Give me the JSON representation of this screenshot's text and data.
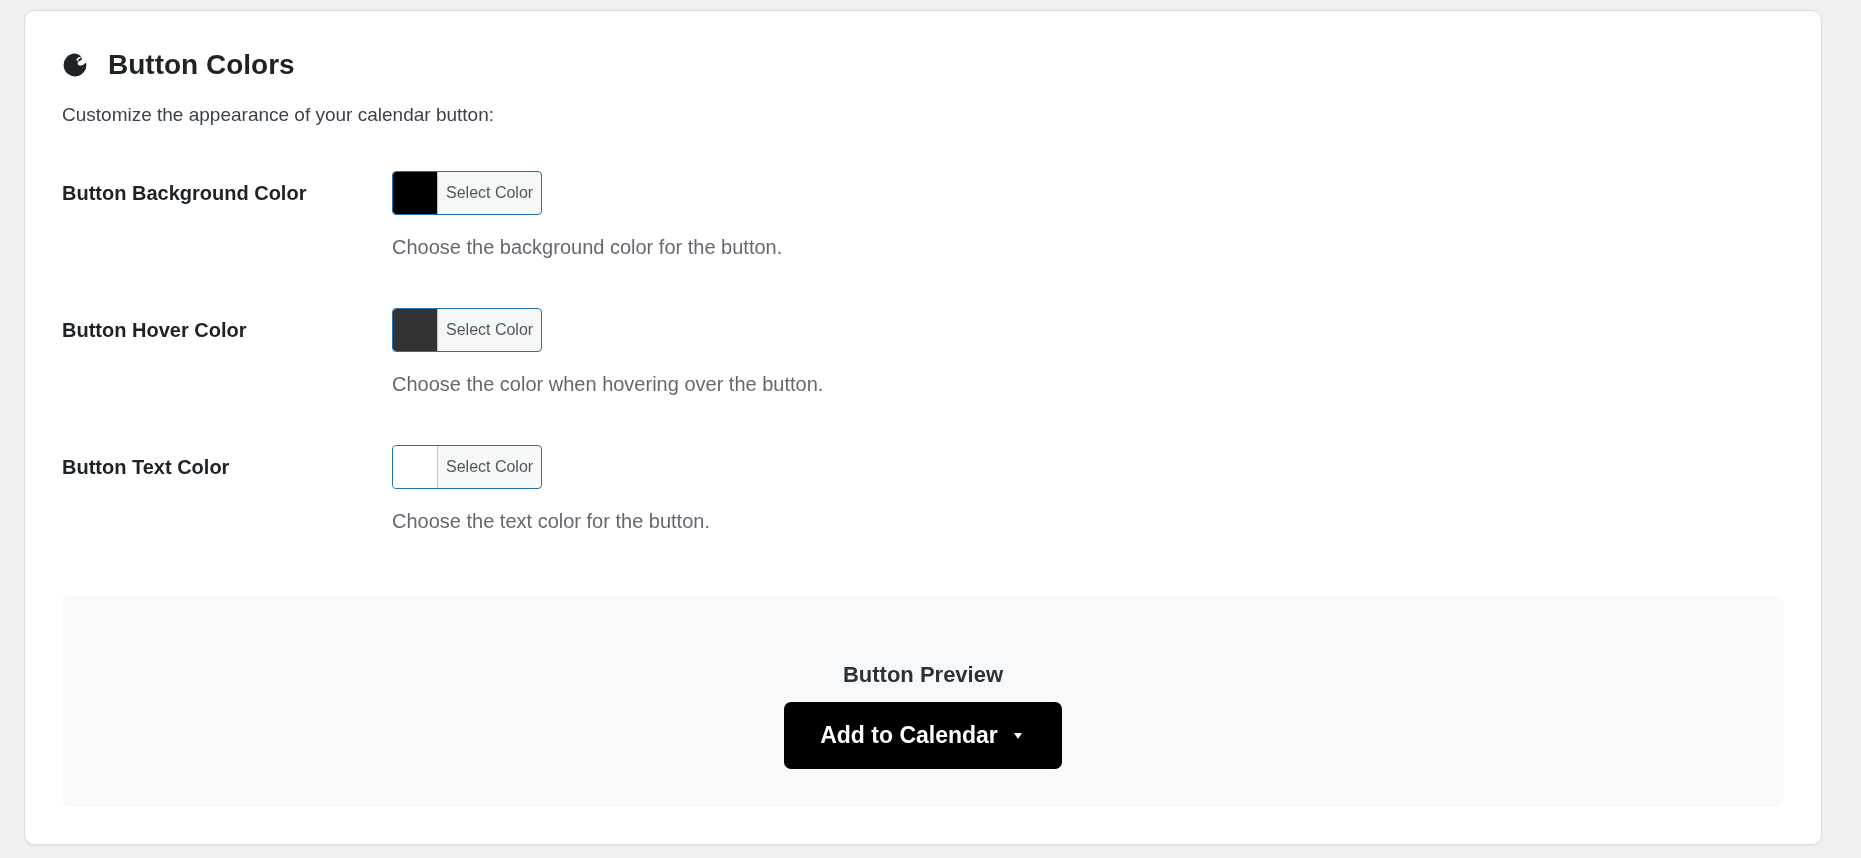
{
  "section": {
    "title": "Button Colors",
    "description": "Customize the appearance of your calendar button:"
  },
  "color_settings": [
    {
      "label": "Button Background Color",
      "color": "#000000",
      "button_label": "Select Color",
      "help": "Choose the background color for the button."
    },
    {
      "label": "Button Hover Color",
      "color": "#333333",
      "button_label": "Select Color",
      "help": "Choose the color when hovering over the button."
    },
    {
      "label": "Button Text Color",
      "color": "#ffffff",
      "button_label": "Select Color",
      "help": "Choose the text color for the button."
    }
  ],
  "preview": {
    "title": "Button Preview",
    "button_label": "Add to Calendar"
  }
}
